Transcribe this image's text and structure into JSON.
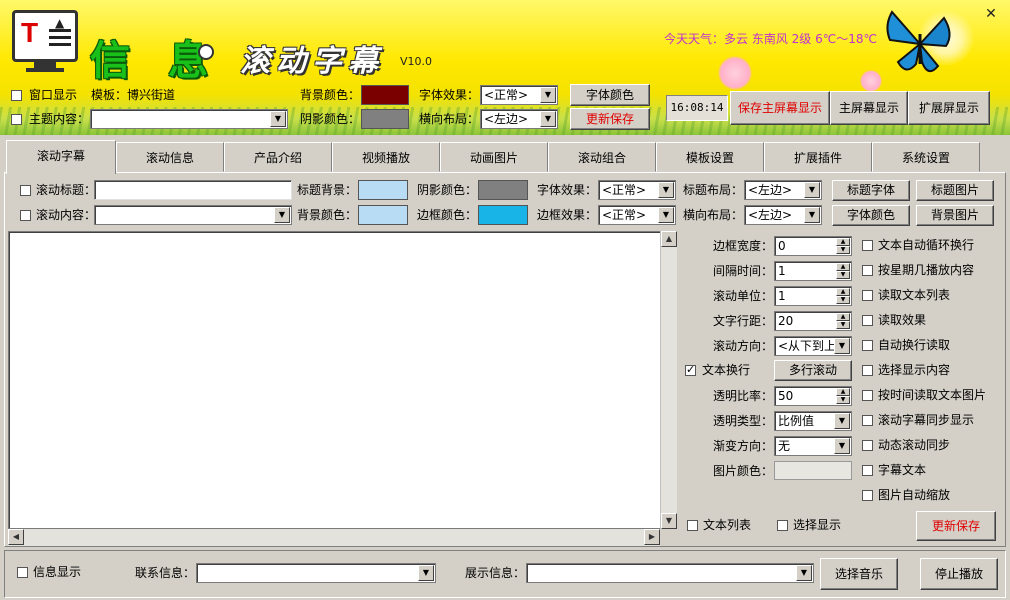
{
  "header": {
    "title_main": "信 息",
    "title_sub": "滚动字幕",
    "version": "V10.0",
    "weather": "今天天气：多云  东南风  2级  6℃～18℃",
    "logo_letter": "T",
    "row1": {
      "window_display_label": "窗口显示",
      "template_label": "模板：博兴街道",
      "bg_color_label": "背景颜色：",
      "font_effect_label": "字体效果：",
      "font_effect_value": "<正常>",
      "font_color_button": "字体颜色"
    },
    "row2": {
      "theme_content_label": "主题内容：",
      "theme_content_value": "",
      "shadow_color_label": "阴影颜色：",
      "h_layout_label": "横向布局：",
      "h_layout_value": "<左边>",
      "update_save_button": "更新保存"
    },
    "time": "16:08:14",
    "save_main_button": "保存主屏幕显示",
    "main_display_button": "主屏幕显示",
    "ext_display_button": "扩展屏显示",
    "colors": {
      "bg": "#7a0000",
      "shadow": "#808080"
    }
  },
  "tabs": [
    {
      "label": "滚动字幕"
    },
    {
      "label": "滚动信息"
    },
    {
      "label": "产品介绍"
    },
    {
      "label": "视频播放"
    },
    {
      "label": "动画图片"
    },
    {
      "label": "滚动组合"
    },
    {
      "label": "模板设置"
    },
    {
      "label": "扩展插件"
    },
    {
      "label": "系统设置"
    }
  ],
  "panel": {
    "scroll_title_label": "滚动标题：",
    "scroll_title_value": "",
    "title_bg_label": "标题背景：",
    "shadow_color_label": "阴影颜色：",
    "font_effect_label": "字体效果：",
    "font_effect_value": "<正常>",
    "title_layout_label": "标题布局：",
    "title_layout_value": "<左边>",
    "title_font_button": "标题字体",
    "title_image_button": "标题图片",
    "scroll_content_label": "滚动内容：",
    "scroll_content_value": "",
    "bg_color_label": "背景颜色：",
    "border_color_label": "边框颜色：",
    "border_effect_label": "边框效果：",
    "border_effect_value": "<正常>",
    "h_layout_label": "横向布局：",
    "h_layout_value": "<左边>",
    "font_color_button": "字体颜色",
    "bg_image_button": "背景图片",
    "colors": {
      "title_bg": "#b8dcf4",
      "shadow": "#808080",
      "bg": "#b8dcf4",
      "border": "#18b4e8"
    },
    "settings": {
      "border_width_label": "边框宽度：",
      "border_width_value": "0",
      "interval_label": "间隔时间：",
      "interval_value": "1",
      "scroll_unit_label": "滚动单位：",
      "scroll_unit_value": "1",
      "line_spacing_label": "文字行距：",
      "line_spacing_value": "20",
      "scroll_dir_label": "滚动方向：",
      "scroll_dir_value": "<从下到上>",
      "text_wrap_label": "文本换行",
      "multi_scroll_button": "多行滚动",
      "opacity_label": "透明比率：",
      "opacity_value": "50",
      "opacity_type_label": "透明类型：",
      "opacity_type_value": "比例值",
      "gradient_label": "渐变方向：",
      "gradient_value": "无",
      "image_color_label": "图片颜色："
    },
    "options": [
      "文本自动循环换行",
      "按星期几播放内容",
      "读取文本列表",
      "读取效果",
      "自动换行读取",
      "选择显示内容",
      "按时间读取文本图片",
      "滚动字幕同步显示",
      "动态滚动同步",
      "字幕文本",
      "图片自动缩放"
    ],
    "text_list_label": "文本列表",
    "select_display_label": "选择显示",
    "update_save_button": "更新保存"
  },
  "bottom": {
    "info_display_label": "信息显示",
    "contact_label": "联系信息：",
    "contact_value": "",
    "show_label": "展示信息：",
    "show_value": "",
    "select_music_button": "选择音乐",
    "stop_play_button": "停止播放"
  }
}
